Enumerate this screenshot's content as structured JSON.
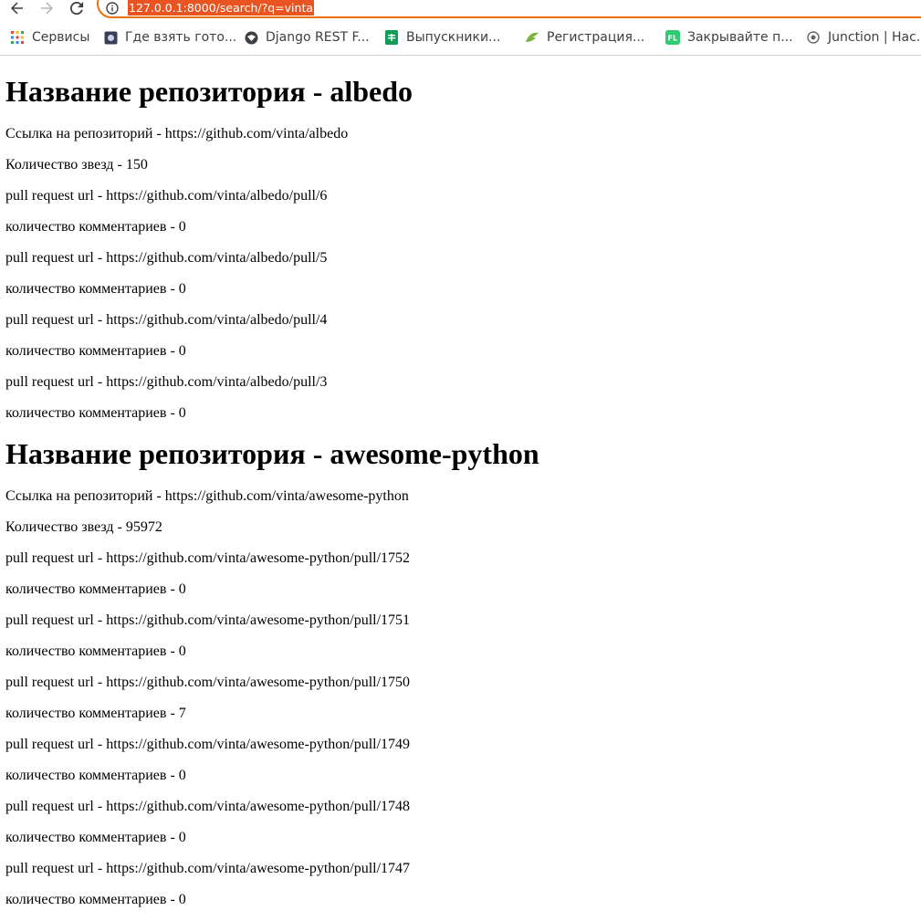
{
  "browser": {
    "url": "127.0.0.1:8000/search/?q=vinta",
    "bookmarks": [
      {
        "label": "Сервисы",
        "icon": "apps-grid-icon"
      },
      {
        "label": "Где взять гото...",
        "icon": "page-icon"
      },
      {
        "label": "Django REST F...",
        "icon": "django-icon"
      },
      {
        "label": "Выпускники...",
        "icon": "sheets-icon"
      },
      {
        "label": "Регистрация...",
        "icon": "leaf-icon"
      },
      {
        "label": "Закрывайте п...",
        "icon": "fl-icon"
      },
      {
        "label": "Junction | Hac...",
        "icon": "junction-icon"
      }
    ]
  },
  "repos": [
    {
      "title": "Название репозитория - albedo",
      "link": "Ссылка на репозиторий - https://github.com/vinta/albedo",
      "stars": "Количество звезд - 150",
      "pulls": [
        {
          "url": "pull request url - https://github.com/vinta/albedo/pull/6",
          "comments": "количество комментариев - 0"
        },
        {
          "url": "pull request url - https://github.com/vinta/albedo/pull/5",
          "comments": "количество комментариев - 0"
        },
        {
          "url": "pull request url - https://github.com/vinta/albedo/pull/4",
          "comments": "количество комментариев - 0"
        },
        {
          "url": "pull request url - https://github.com/vinta/albedo/pull/3",
          "comments": "количество комментариев - 0"
        }
      ]
    },
    {
      "title": "Название репозитория - awesome-python",
      "link": "Ссылка на репозиторий - https://github.com/vinta/awesome-python",
      "stars": "Количество звезд - 95972",
      "pulls": [
        {
          "url": "pull request url - https://github.com/vinta/awesome-python/pull/1752",
          "comments": "количество комментариев - 0"
        },
        {
          "url": "pull request url - https://github.com/vinta/awesome-python/pull/1751",
          "comments": "количество комментариев - 0"
        },
        {
          "url": "pull request url - https://github.com/vinta/awesome-python/pull/1750",
          "comments": "количество комментариев - 7"
        },
        {
          "url": "pull request url - https://github.com/vinta/awesome-python/pull/1749",
          "comments": "количество комментариев - 0"
        },
        {
          "url": "pull request url - https://github.com/vinta/awesome-python/pull/1748",
          "comments": "количество комментариев - 0"
        },
        {
          "url": "pull request url - https://github.com/vinta/awesome-python/pull/1747",
          "comments": "количество комментариев - 0"
        }
      ]
    }
  ]
}
